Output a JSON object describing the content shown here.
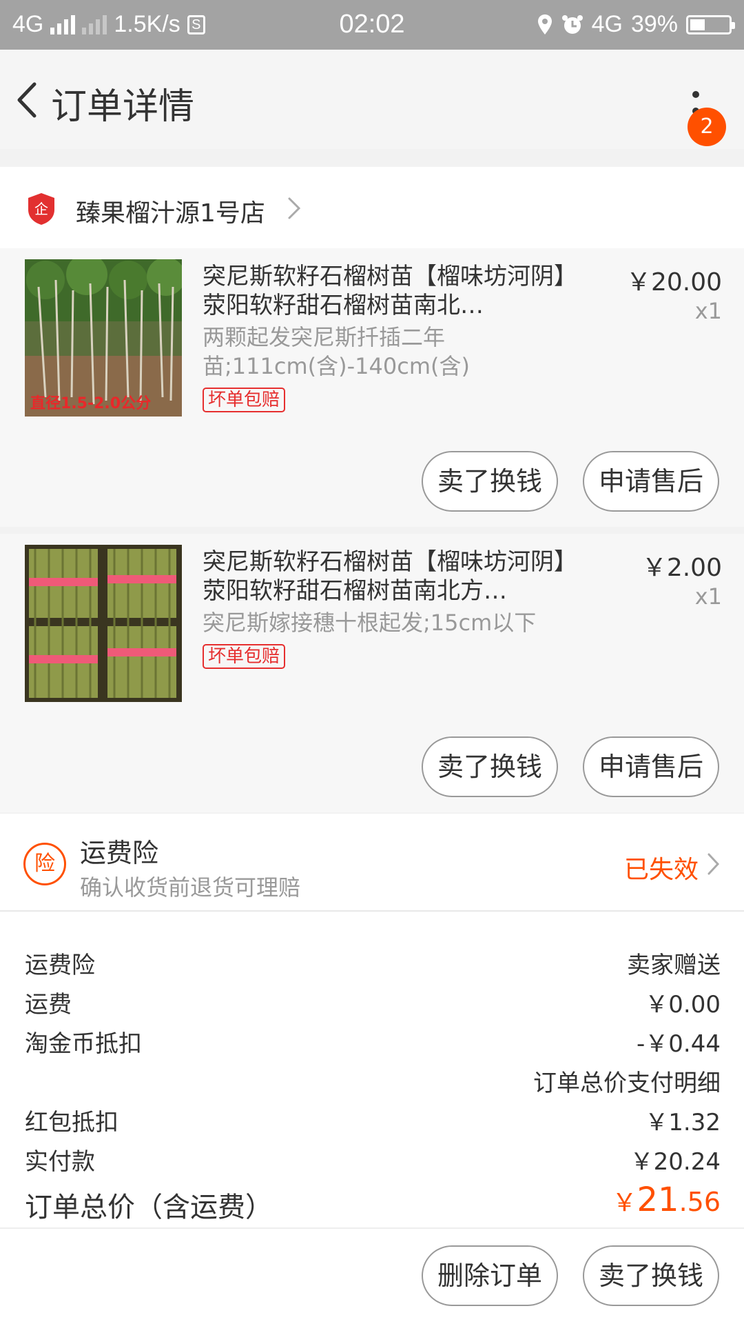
{
  "status_bar": {
    "network_left": "4G",
    "speed": "1.5K/s",
    "time": "02:02",
    "network_right": "4G",
    "battery_percent": "39%",
    "battery_level": 0.39
  },
  "nav": {
    "title": "订单详情",
    "badge_count": "2"
  },
  "shop": {
    "name": "臻果榴汁源1号店"
  },
  "items": [
    {
      "title": "突尼斯软籽石榴树苗【榴味坊河阴】荥阳软籽甜石榴树苗南北…",
      "sku": "两颗起发突尼斯扦插二年苗;111cm(含)-140cm(含)",
      "tag": "坏单包赔",
      "price": "￥20.00",
      "qty": "x1",
      "image_text": "直径1.5-2.0公分",
      "btn_sell": "卖了换钱",
      "btn_aftersale": "申请售后"
    },
    {
      "title": "突尼斯软籽石榴树苗【榴味坊河阴】荥阳软籽甜石榴树苗南北方…",
      "sku": "突尼斯嫁接穗十根起发;15cm以下",
      "tag": "坏单包赔",
      "price": "￥2.00",
      "qty": "x1",
      "btn_sell": "卖了换钱",
      "btn_aftersale": "申请售后"
    }
  ],
  "insurance": {
    "icon_text": "险",
    "title": "运费险",
    "desc": "确认收货前退货可理赔",
    "status": "已失效"
  },
  "summary": {
    "rows": [
      {
        "label": "运费险",
        "value": "卖家赠送"
      },
      {
        "label": "运费",
        "value": "￥0.00"
      },
      {
        "label": "淘金币抵扣",
        "value": "-￥0.44"
      },
      {
        "label": "",
        "value": "订单总价支付明细"
      },
      {
        "label": "红包抵扣",
        "value": "￥1.32"
      },
      {
        "label": "实付款",
        "value": "￥20.24"
      }
    ],
    "total_label": "订单总价（含运费）",
    "total_currency": "￥",
    "total_int": "21",
    "total_dec": ".56"
  },
  "footer": {
    "delete_label": "删除订单",
    "sell_label": "卖了换钱"
  },
  "colors": {
    "accent": "#ff5000",
    "tag_red": "#e62e2e"
  }
}
